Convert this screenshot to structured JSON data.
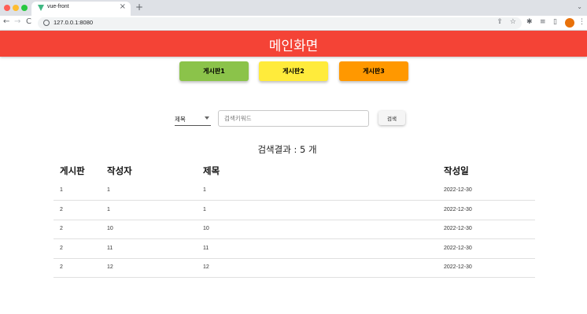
{
  "browser": {
    "tab_title": "vue-front",
    "tab_close": "×",
    "new_tab": "+",
    "tab_dropdown": "⌄",
    "nav": {
      "back": "←",
      "forward": "→",
      "reload": "C"
    },
    "url": "127.0.0.1:8080",
    "icons": {
      "share": "⇪",
      "star": "☆",
      "extensions": "✱",
      "reading_list": "≡",
      "side_panel": "▯",
      "menu": "⋮"
    }
  },
  "header": {
    "title": "메인화면",
    "color": "#f44336"
  },
  "boards": [
    {
      "label": "게시판1",
      "color": "#8bc34a"
    },
    {
      "label": "게시판2",
      "color": "#ffeb3b"
    },
    {
      "label": "게시판3",
      "color": "#ff9800"
    }
  ],
  "search": {
    "field_selected": "제목",
    "placeholder": "검색키워드",
    "value": "",
    "button_label": "검색"
  },
  "result": {
    "text": "검색결과 : 5 개"
  },
  "table": {
    "headers": [
      "게시판",
      "작성자",
      "제목",
      "작성일"
    ],
    "rows": [
      [
        "1",
        "1",
        "1",
        "2022-12-30"
      ],
      [
        "2",
        "1",
        "1",
        "2022-12-30"
      ],
      [
        "2",
        "10",
        "10",
        "2022-12-30"
      ],
      [
        "2",
        "11",
        "11",
        "2022-12-30"
      ],
      [
        "2",
        "12",
        "12",
        "2022-12-30"
      ]
    ]
  }
}
